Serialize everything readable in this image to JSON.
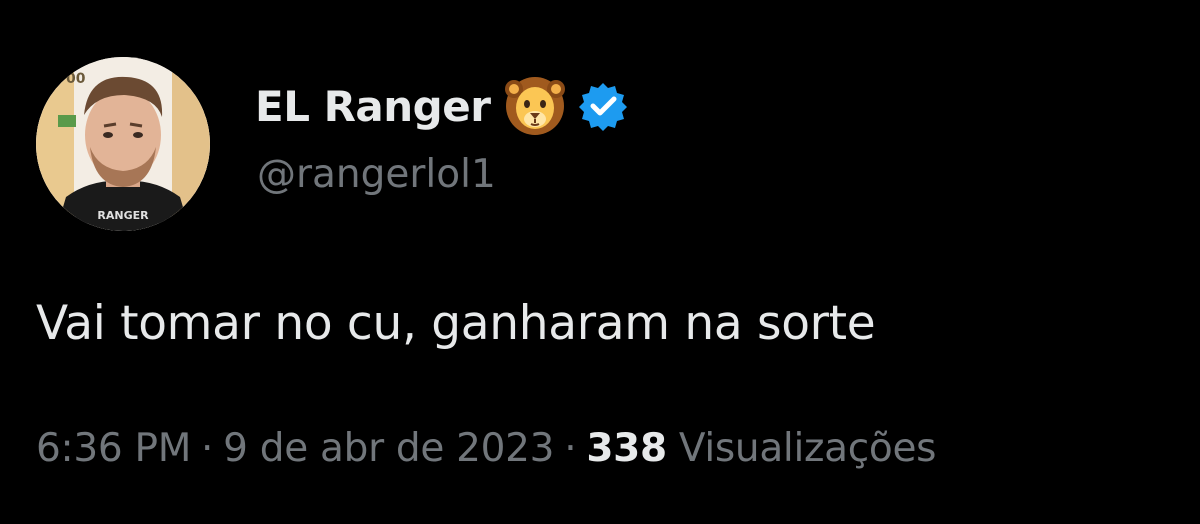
{
  "author": {
    "display_name": "EL Ranger",
    "emoji": "lion-face",
    "verified": true,
    "handle": "@rangerlol1",
    "avatar_caption": "RANGER"
  },
  "tweet": {
    "text": "Vai tomar no cu, ganharam na sorte"
  },
  "meta": {
    "time": "6:36 PM",
    "separator": "·",
    "date": "9 de abr de 2023",
    "views_count": "338",
    "views_label": "Visualizações"
  },
  "colors": {
    "background": "#000000",
    "primary_text": "#e7e9ea",
    "secondary_text": "#71767b",
    "verified_badge": "#1d9bf0"
  }
}
